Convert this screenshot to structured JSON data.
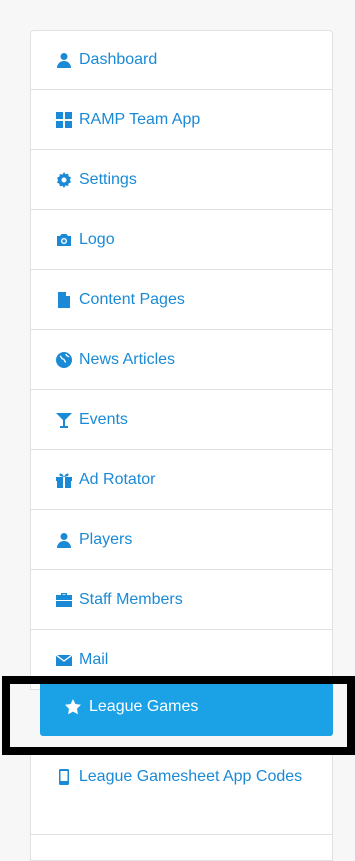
{
  "nav": {
    "items": [
      {
        "label": "Dashboard",
        "icon": "user-icon"
      },
      {
        "label": "RAMP Team App",
        "icon": "grid-icon"
      },
      {
        "label": "Settings",
        "icon": "gear-icon"
      },
      {
        "label": "Logo",
        "icon": "camera-icon"
      },
      {
        "label": "Content Pages",
        "icon": "file-icon"
      },
      {
        "label": "News Articles",
        "icon": "globe-icon"
      },
      {
        "label": "Events",
        "icon": "cocktail-icon"
      },
      {
        "label": "Ad Rotator",
        "icon": "gift-icon"
      },
      {
        "label": "Players",
        "icon": "user-icon"
      },
      {
        "label": "Staff Members",
        "icon": "briefcase-icon"
      },
      {
        "label": "Mail",
        "icon": "envelope-icon"
      },
      {
        "label": "League Gamesheet App Codes",
        "icon": "mobile-icon"
      }
    ],
    "active": {
      "label": "League Games",
      "icon": "star-icon"
    }
  },
  "colors": {
    "link": "#1a8ad6",
    "active_bg": "#1aa1e6",
    "highlight_border": "#000000"
  }
}
